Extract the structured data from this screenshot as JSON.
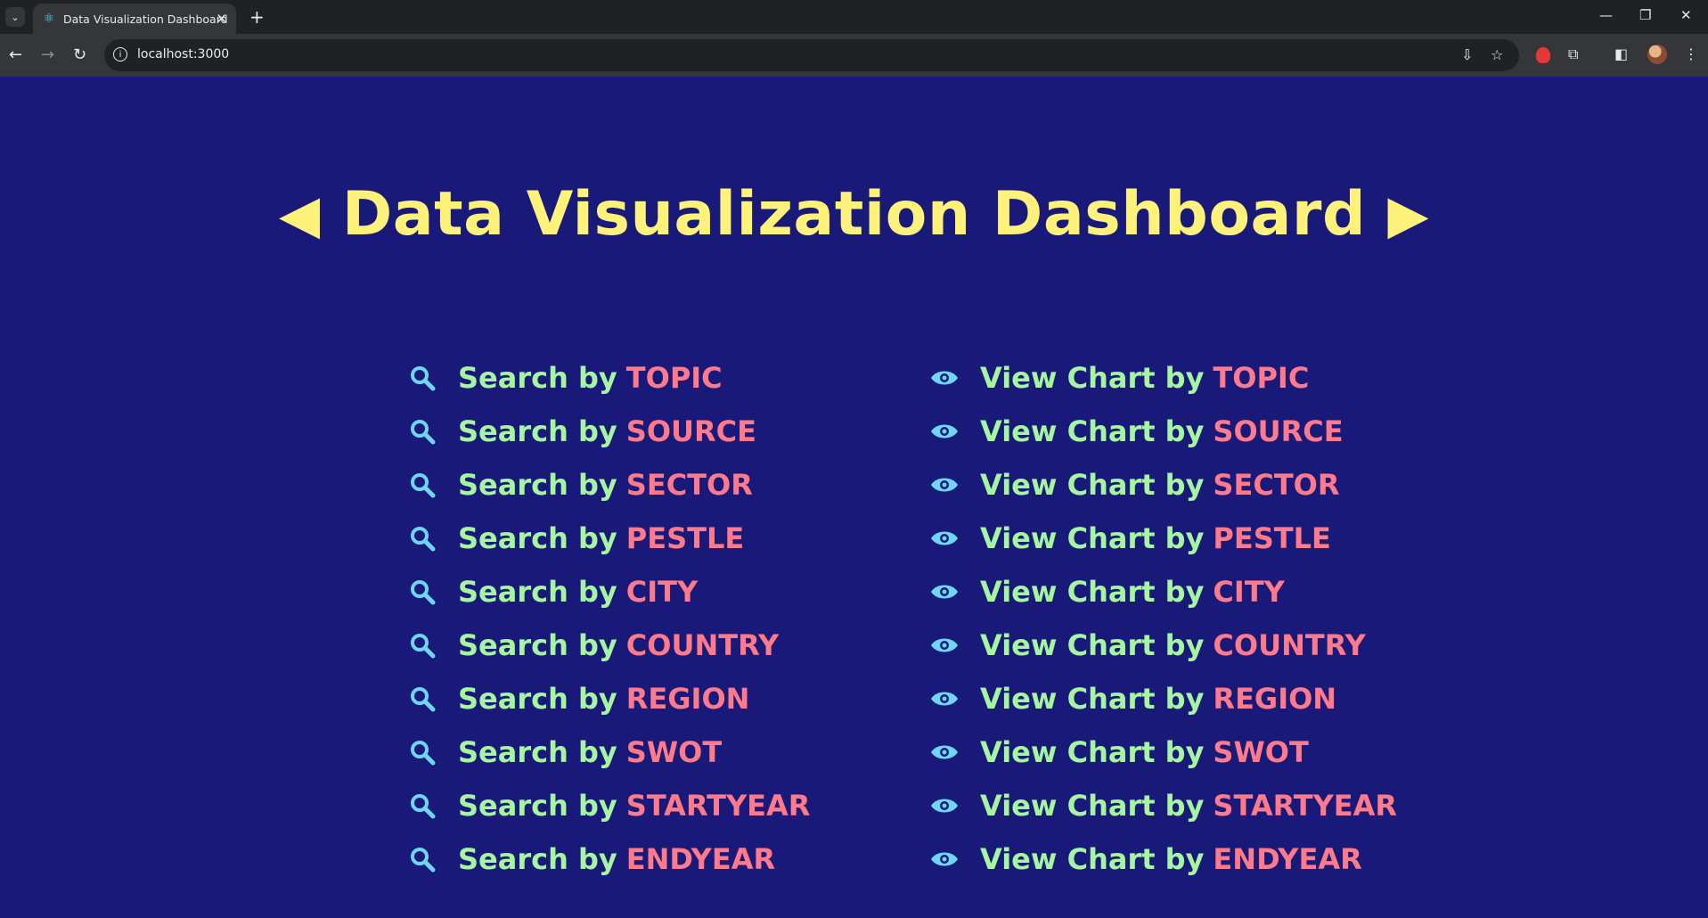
{
  "browser": {
    "tab_title": "Data Visualization Dashboard",
    "url": "localhost:3000"
  },
  "page": {
    "heading": "Data Visualization Dashboard",
    "left_arrow": "◀",
    "right_arrow": "▶",
    "search_prefix": "Search by",
    "chart_prefix": "View Chart by",
    "search_items": [
      "TOPIC",
      "SOURCE",
      "SECTOR",
      "PESTLE",
      "CITY",
      "COUNTRY",
      "REGION",
      "SWOT",
      "STARTYEAR",
      "ENDYEAR"
    ],
    "chart_items": [
      "TOPIC",
      "SOURCE",
      "SECTOR",
      "PESTLE",
      "CITY",
      "COUNTRY",
      "REGION",
      "SWOT",
      "STARTYEAR",
      "ENDYEAR"
    ]
  },
  "colors": {
    "background": "#19197a",
    "heading": "#fff27a",
    "label": "#a6f5a0",
    "keyword": "#ff7a8a",
    "icon": "#6fd6f2"
  },
  "icons": {
    "search": "magnifier-icon",
    "chart": "eye-icon"
  }
}
